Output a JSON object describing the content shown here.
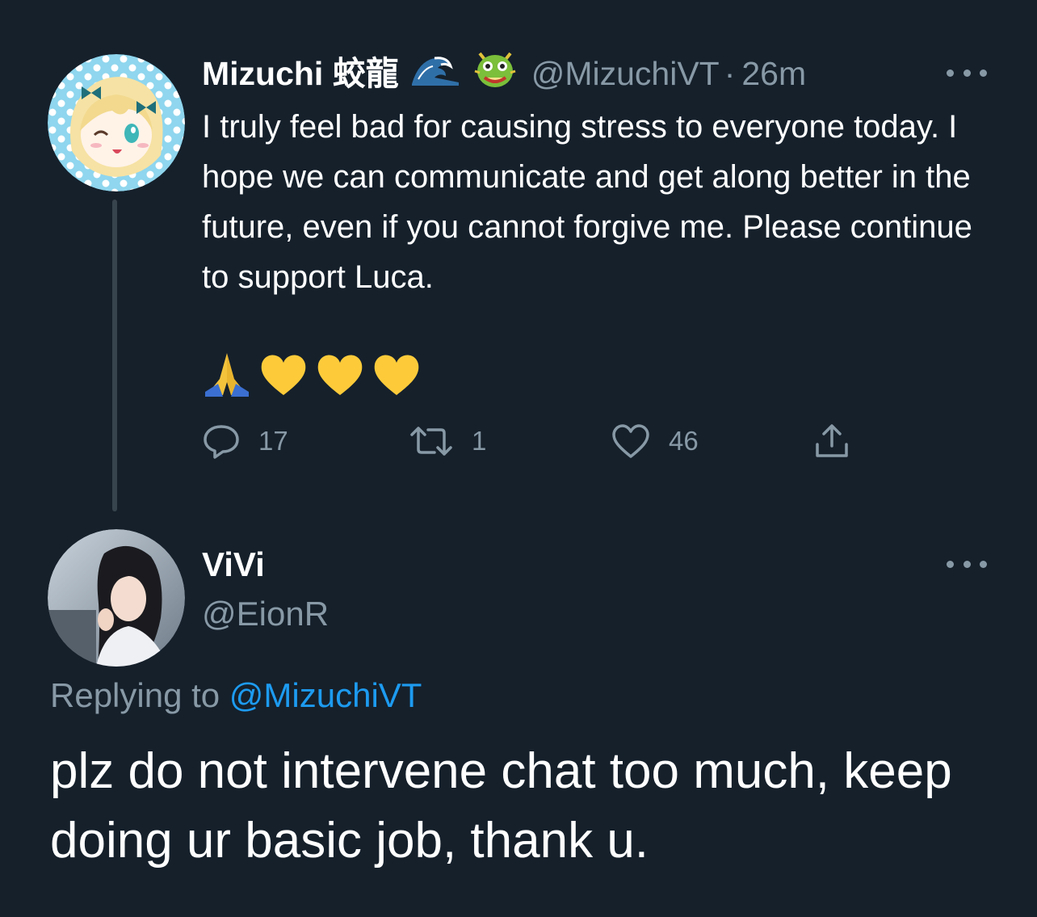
{
  "colors": {
    "background": "#15202b",
    "text_primary": "#ffffff",
    "text_secondary": "#8899a6",
    "link": "#1d9bf0",
    "thread_line": "#38444d"
  },
  "parent_tweet": {
    "author_name": "Mizuchi 蛟龍",
    "name_emojis": [
      "🌊",
      "🐲"
    ],
    "handle": "@MizuchiVT",
    "separator": "·",
    "time": "26m",
    "text": "I truly feel bad for causing stress to everyone today. I hope we can communicate and get along better in the future, even if you cannot forgive me. Please continue to support Luca.",
    "body_emojis": [
      "🙏",
      "💛",
      "💛",
      "💛"
    ],
    "avatar_icon": "anime-character-avatar",
    "actions": {
      "reply": {
        "icon": "reply-icon",
        "count": "17"
      },
      "retweet": {
        "icon": "retweet-icon",
        "count": "1"
      },
      "like": {
        "icon": "like-icon",
        "count": "46"
      },
      "share": {
        "icon": "share-icon"
      }
    }
  },
  "reply_tweet": {
    "author_name": "ViVi",
    "handle": "@EionR",
    "avatar_icon": "profile-photo-avatar",
    "replying_prefix": "Replying to ",
    "replying_handle": "@MizuchiVT",
    "text": "plz do not intervene chat too much, keep doing ur basic job, thank u."
  }
}
